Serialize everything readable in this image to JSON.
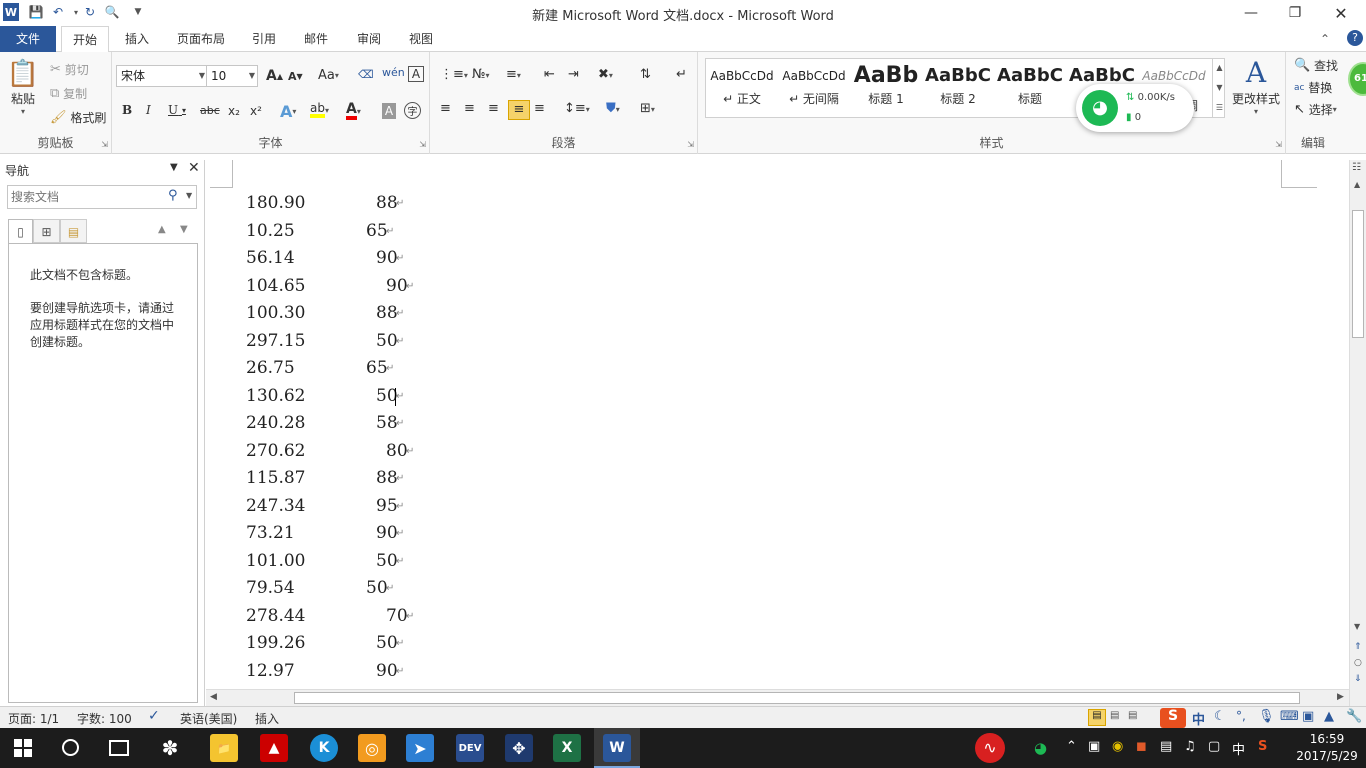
{
  "window": {
    "title": "新建 Microsoft Word 文档.docx - Microsoft Word"
  },
  "qat": {
    "word_icon": "W",
    "save": "save-icon",
    "undo": "undo-icon",
    "redo": "redo-icon"
  },
  "tabs": [
    "文件",
    "开始",
    "插入",
    "页面布局",
    "引用",
    "邮件",
    "审阅",
    "视图"
  ],
  "ribbon": {
    "clipboard": {
      "paste": "粘贴",
      "cut": "剪切",
      "copy": "复制",
      "format_painter": "格式刷",
      "label": "剪贴板"
    },
    "font": {
      "font_name": "宋体",
      "font_size": "10",
      "label": "字体",
      "bold": "B",
      "italic": "I",
      "underline": "U",
      "strike": "abc",
      "sub": "x₂",
      "sup": "x²",
      "grow": "A",
      "shrink": "A",
      "case": "Aa"
    },
    "paragraph": {
      "label": "段落"
    },
    "styles": {
      "label": "样式",
      "items": [
        {
          "preview": "AaBbCcDd",
          "name": "↵ 正文"
        },
        {
          "preview": "AaBbCcDd",
          "name": "↵ 无间隔"
        },
        {
          "preview": "AaBb",
          "name": "标题 1"
        },
        {
          "preview": "AaBbC",
          "name": "标题 2"
        },
        {
          "preview": "AaBbC",
          "name": "标题"
        },
        {
          "preview": "AaBbC",
          "name": ""
        },
        {
          "preview": "AaBbCcDd",
          "name": ""
        }
      ],
      "partial_name": "调",
      "change_styles": "更改样式"
    },
    "editing": {
      "label": "编辑",
      "find": "查找",
      "replace": "替换",
      "select": "选择"
    }
  },
  "net_widget": {
    "speed": "0.00K/s",
    "count": "0"
  },
  "avatar_badge": "61",
  "nav": {
    "title": "导航",
    "search_placeholder": "搜索文档",
    "no_headings": "此文档不包含标题。",
    "hint": "要创建导航选项卡，请通过应用标题样式在您的文档中创建标题。"
  },
  "document": {
    "rows": [
      {
        "a": "180.90",
        "b": "88"
      },
      {
        "a": "10.25",
        "b": "65"
      },
      {
        "a": "56.14",
        "b": "90"
      },
      {
        "a": "104.65",
        "b": "90"
      },
      {
        "a": "100.30",
        "b": "88"
      },
      {
        "a": "297.15",
        "b": "50"
      },
      {
        "a": "26.75",
        "b": "65"
      },
      {
        "a": "130.62",
        "b": "50"
      },
      {
        "a": "240.28",
        "b": "58"
      },
      {
        "a": "270.62",
        "b": "80"
      },
      {
        "a": "115.87",
        "b": "88"
      },
      {
        "a": "247.34",
        "b": "95"
      },
      {
        "a": "73.21",
        "b": "90"
      },
      {
        "a": "101.00",
        "b": "50"
      },
      {
        "a": "79.54",
        "b": "50"
      },
      {
        "a": "278.44",
        "b": "70"
      },
      {
        "a": "199.26",
        "b": "50"
      },
      {
        "a": "12.97",
        "b": "90"
      }
    ]
  },
  "status": {
    "page": "页面: 1/1",
    "words": "字数: 100",
    "language": "英语(美国)",
    "mode": "插入"
  },
  "ime": {
    "lang": "中"
  },
  "taskbar": {
    "apps": [
      "DEV",
      "K",
      "W"
    ],
    "tray_lang": "中",
    "time": "16:59",
    "date": "2017/5/29"
  },
  "colors": {
    "accent": "#2b579a",
    "taskbar": "#1c1c1c",
    "wifi_green": "#1db954"
  }
}
